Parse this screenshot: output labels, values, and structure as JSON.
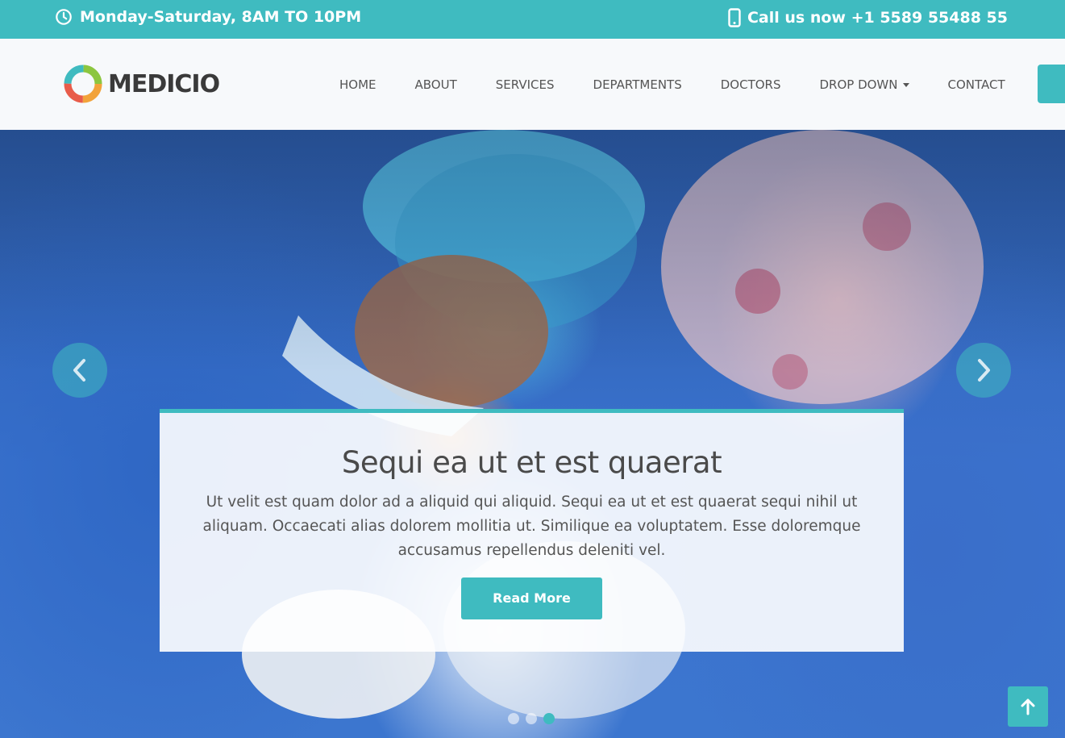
{
  "topbar": {
    "hours": "Monday-Saturday, 8AM TO 10PM",
    "phone": "Call us now +1 5589 55488 55",
    "hours_icon": "clock-icon",
    "phone_icon": "phone-icon"
  },
  "brand": {
    "name": "MEDICIO",
    "accent": "#3fbbc0"
  },
  "nav": {
    "items": [
      "HOME",
      "ABOUT",
      "SERVICES",
      "DEPARTMENTS",
      "DOCTORS",
      "DROP DOWN",
      "CONTACT"
    ]
  },
  "hero": {
    "title": "Sequi ea ut et est quaerat",
    "text": "Ut velit est quam dolor ad a aliquid qui aliquid. Sequi ea ut et est quaerat sequi nihil ut aliquam. Occaecati alias dolorem mollitia ut. Similique ea voluptatem. Esse doloremque accusamus repellendus deleniti vel.",
    "button": "Read More",
    "slide_count": 3,
    "active_slide": 3
  }
}
